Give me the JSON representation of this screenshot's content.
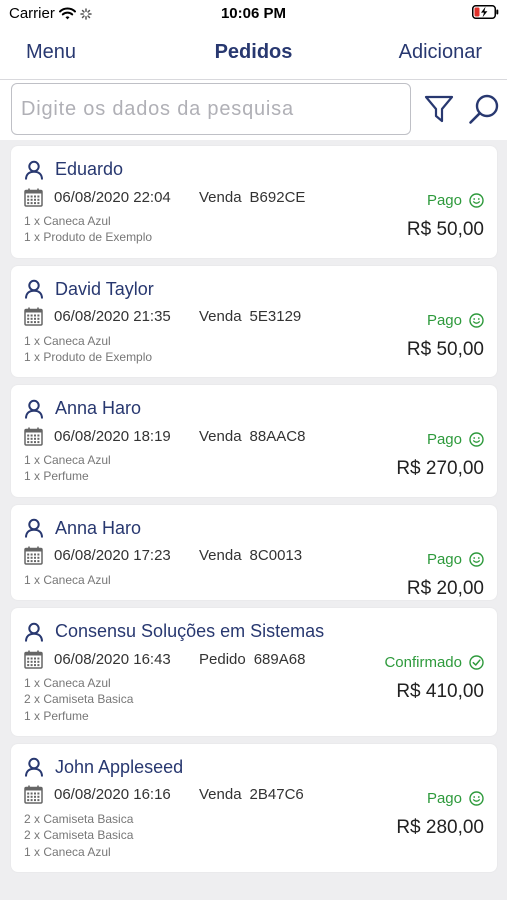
{
  "status_bar": {
    "carrier": "Carrier",
    "time": "10:06 PM"
  },
  "nav": {
    "left": "Menu",
    "title": "Pedidos",
    "right": "Adicionar"
  },
  "search": {
    "placeholder": "Digite os dados da pesquisa",
    "value": ""
  },
  "colors": {
    "primary": "#283870",
    "success": "#2e9a3c",
    "text": "#333333",
    "muted": "#777777"
  },
  "orders": [
    {
      "customer": "Eduardo",
      "date": "06/08/2020 22:04",
      "type": "Venda",
      "code": "B692CE",
      "status": "Pago",
      "status_icon": "smile-icon",
      "total": "R$ 50,00",
      "items": [
        "1 x Caneca Azul",
        "1 x Produto de Exemplo"
      ]
    },
    {
      "customer": "David Taylor",
      "date": "06/08/2020 21:35",
      "type": "Venda",
      "code": "5E3129",
      "status": "Pago",
      "status_icon": "smile-icon",
      "total": "R$ 50,00",
      "items": [
        "1 x Caneca Azul",
        "1 x Produto de Exemplo"
      ]
    },
    {
      "customer": "Anna Haro",
      "date": "06/08/2020 18:19",
      "type": "Venda",
      "code": "88AAC8",
      "status": "Pago",
      "status_icon": "smile-icon",
      "total": "R$ 270,00",
      "items": [
        "1 x Caneca Azul",
        "1 x Perfume"
      ]
    },
    {
      "customer": "Anna Haro",
      "date": "06/08/2020 17:23",
      "type": "Venda",
      "code": "8C0013",
      "status": "Pago",
      "status_icon": "smile-icon",
      "total": "R$ 20,00",
      "items": [
        "1 x Caneca Azul"
      ]
    },
    {
      "customer": "Consensu Soluções em Sistemas",
      "date": "06/08/2020 16:43",
      "type": "Pedido",
      "code": "689A68",
      "status": "Confirmado",
      "status_icon": "check-circle-icon",
      "total": "R$ 410,00",
      "items": [
        "1 x Caneca Azul",
        "2 x Camiseta Basica",
        "1 x Perfume"
      ]
    },
    {
      "customer": "John Appleseed",
      "date": "06/08/2020 16:16",
      "type": "Venda",
      "code": "2B47C6",
      "status": "Pago",
      "status_icon": "smile-icon",
      "total": "R$ 280,00",
      "items": [
        "2 x Camiseta Basica",
        "2 x Camiseta Basica",
        "1 x Caneca Azul"
      ]
    }
  ]
}
